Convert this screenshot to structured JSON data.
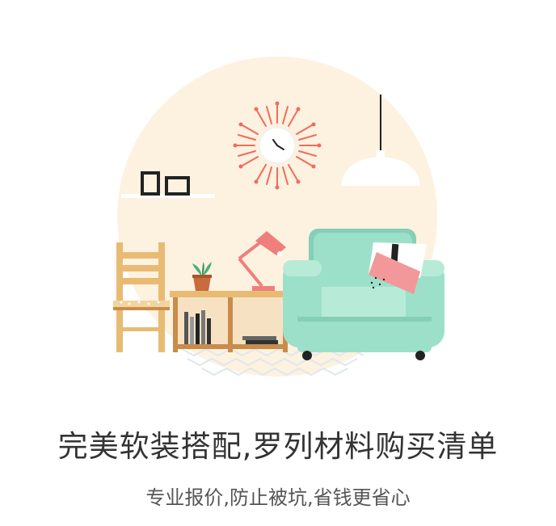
{
  "headline": "完美软装搭配,罗列材料购买清单",
  "subline": "专业报价,防止被坑,省钱更省心",
  "colors": {
    "circle_bg": "#fdf1e0",
    "sofa": "#9de0c9",
    "sofa_shadow": "#84cfb5",
    "wood": "#e8bb73",
    "wood_dark": "#c98c4a",
    "lamp": "#ee7f7b",
    "clock_rays": "#ee6d5d",
    "text_main": "#333333",
    "text_sub": "#555555"
  },
  "icons": {
    "clock": "wall-clock-icon",
    "pendant_lamp": "pendant-lamp-icon",
    "desk_lamp": "desk-lamp-icon",
    "armchair": "armchair-icon",
    "chair": "wooden-chair-icon",
    "plant": "potted-plant-icon",
    "frames": "picture-frames-icon",
    "shelf": "bookshelf-table-icon"
  }
}
